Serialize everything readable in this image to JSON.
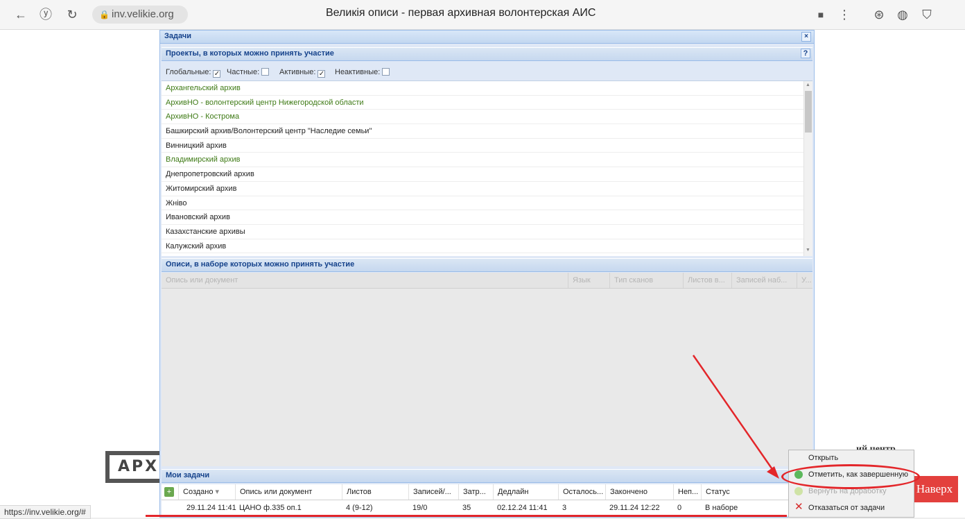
{
  "browser": {
    "url": "inv.velikie.org",
    "page_title": "Великія описи - первая архивная волонтерская АИС",
    "status_url": "https://inv.velikie.org/#"
  },
  "window": {
    "title": "Задачи",
    "close_label": "×"
  },
  "projects": {
    "title": "Проекты, в которых можно принять участие",
    "help_label": "?",
    "filters": [
      {
        "label": "Глобальные:",
        "checked": true
      },
      {
        "label": "Частные:",
        "checked": false
      },
      {
        "label": "Активные:",
        "checked": true
      },
      {
        "label": "Неактивные:",
        "checked": false
      }
    ],
    "items": [
      {
        "label": "Архангельский архив",
        "active": true
      },
      {
        "label": "АрхивНО - волонтерский центр Нижегородской области",
        "active": true
      },
      {
        "label": "АрхивНО - Кострома",
        "active": true
      },
      {
        "label": "Башкирский архив/Волонтерский центр \"Наследие семьи\"",
        "active": false
      },
      {
        "label": "Винницкий архив",
        "active": false
      },
      {
        "label": "Владимирский архив",
        "active": true
      },
      {
        "label": "Днепропетровский архив",
        "active": false
      },
      {
        "label": "Житомирский архив",
        "active": false
      },
      {
        "label": "Жніво",
        "active": false
      },
      {
        "label": "Ивановский архив",
        "active": false
      },
      {
        "label": "Казахстанские архивы",
        "active": false
      },
      {
        "label": "Калужский архив",
        "active": false
      }
    ]
  },
  "inventories": {
    "title": "Описи, в наборе которых можно принять участие",
    "columns": [
      "Опись или документ",
      "Язык",
      "Тип сканов",
      "Листов в...",
      "Записей наб...",
      "У..."
    ]
  },
  "my_tasks": {
    "title": "Мои задачи",
    "columns": [
      "Создано",
      "Опись или документ",
      "Листов",
      "Записей/...",
      "Затр...",
      "Дедлайн",
      "Осталось...",
      "Закончено",
      "Неп...",
      "Статус"
    ],
    "sort_indicator": "▾",
    "rows": [
      [
        "29.11.24 11:41",
        "ЦАНО ф.335 оп.1",
        "4 (9-12)",
        "19/0",
        "35",
        "02.12.24 11:41",
        "3",
        "29.11.24 12:22",
        "0",
        "В наборе"
      ]
    ]
  },
  "context_menu": {
    "items": [
      {
        "label": "Открыть",
        "icon": "none",
        "disabled": false
      },
      {
        "label": "Отметить, как завершенную",
        "icon": "check-circle",
        "disabled": false
      },
      {
        "label": "Вернуть на доработку",
        "icon": "return-circle",
        "disabled": true
      },
      {
        "label": "Отказаться от задачи",
        "icon": "red-x",
        "disabled": false
      }
    ]
  },
  "background": {
    "logo_text": "АРХ",
    "right_fragment": "ий центр",
    "up_button": "Наверх"
  },
  "colors": {
    "accent_red": "#e3262a",
    "active_project": "#3e7a15",
    "panel_title": "#15428b"
  }
}
